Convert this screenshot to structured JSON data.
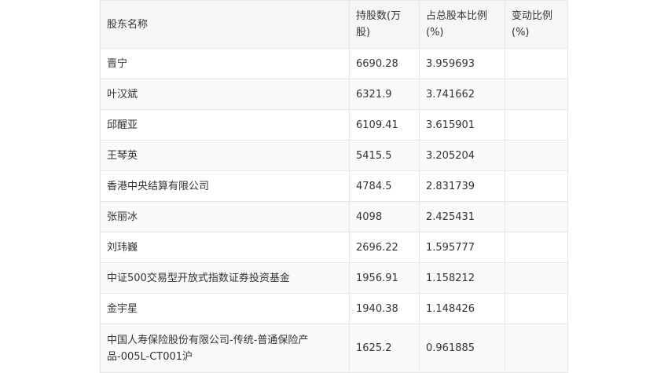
{
  "table": {
    "headers": [
      "股东名称",
      "持股数(万股)",
      "占总股本比例(%)",
      "变动比例(%)"
    ],
    "rows": [
      [
        "晋宁",
        "6690.28",
        "3.959693",
        ""
      ],
      [
        "叶汉斌",
        "6321.9",
        "3.741662",
        ""
      ],
      [
        "邱醒亚",
        "6109.41",
        "3.615901",
        ""
      ],
      [
        "王琴英",
        "5415.5",
        "3.205204",
        ""
      ],
      [
        "香港中央结算有限公司",
        "4784.5",
        "2.831739",
        ""
      ],
      [
        "张丽冰",
        "4098",
        "2.425431",
        ""
      ],
      [
        "刘玮巍",
        "2696.22",
        "1.595777",
        ""
      ],
      [
        "中证500交易型开放式指数证券投资基金",
        "1956.91",
        "1.158212",
        ""
      ],
      [
        "金宇星",
        "1940.38",
        "1.148426",
        ""
      ],
      [
        "中国人寿保险股份有限公司-传统-普通保险产品-005L-CT001沪",
        "1625.2",
        "0.961885",
        ""
      ]
    ]
  }
}
